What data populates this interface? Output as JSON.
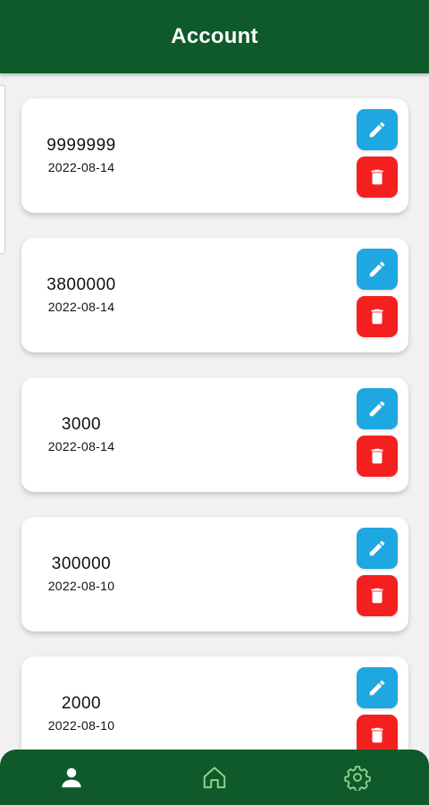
{
  "header": {
    "title": "Account",
    "background": "#0f5a2a"
  },
  "records": [
    {
      "amount": "9999999",
      "date": "2022-08-14"
    },
    {
      "amount": "3800000",
      "date": "2022-08-14"
    },
    {
      "amount": "3000",
      "date": "2022-08-14"
    },
    {
      "amount": "300000",
      "date": "2022-08-10"
    },
    {
      "amount": "2000",
      "date": "2022-08-10"
    }
  ],
  "actions": {
    "edit_icon": "pencil-icon",
    "delete_icon": "trash-icon",
    "edit_color": "#1ea7e1",
    "delete_color": "#f42020"
  },
  "bottom_nav": {
    "items": [
      {
        "icon": "person-icon",
        "active": true
      },
      {
        "icon": "home-icon",
        "active": false
      },
      {
        "icon": "gear-icon",
        "active": false
      }
    ],
    "active_color": "#ffffff",
    "inactive_color": "#8fd18f"
  }
}
